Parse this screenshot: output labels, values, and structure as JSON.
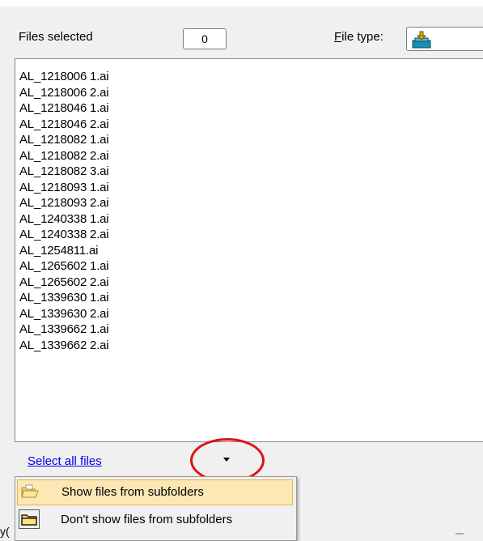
{
  "header": {
    "files_selected_label": "Files selected",
    "files_selected_count": "0",
    "file_type_label_accel": "F",
    "file_type_label_rest": "ile type:"
  },
  "file_list": {
    "items": [
      "AL_1218006 1.ai",
      "AL_1218006 2.ai",
      "AL_1218046 1.ai",
      "AL_1218046 2.ai",
      "AL_1218082 1.ai",
      "AL_1218082 2.ai",
      "AL_1218082 3.ai",
      "AL_1218093 1.ai",
      "AL_1218093 2.ai",
      "AL_1240338 1.ai",
      "AL_1240338 2.ai",
      "AL_1254811.ai",
      "AL_1265602 1.ai",
      "AL_1265602 2.ai",
      "AL_1339630 1.ai",
      "AL_1339630 2.ai",
      "AL_1339662 1.ai",
      "AL_1339662 2.ai"
    ]
  },
  "footer": {
    "select_all_label": "Select all files",
    "partial_text": "y("
  },
  "menu": {
    "items": [
      {
        "label": "Show files from subfolders",
        "icon": "folder-open-icon",
        "highlighted": true
      },
      {
        "label": "Don't show files from subfolders",
        "icon": "folder-icon",
        "highlighted": false
      }
    ]
  },
  "colors": {
    "link": "#0000ee",
    "annotation_circle": "#e01010",
    "menu_highlight": "#fce8b5"
  }
}
